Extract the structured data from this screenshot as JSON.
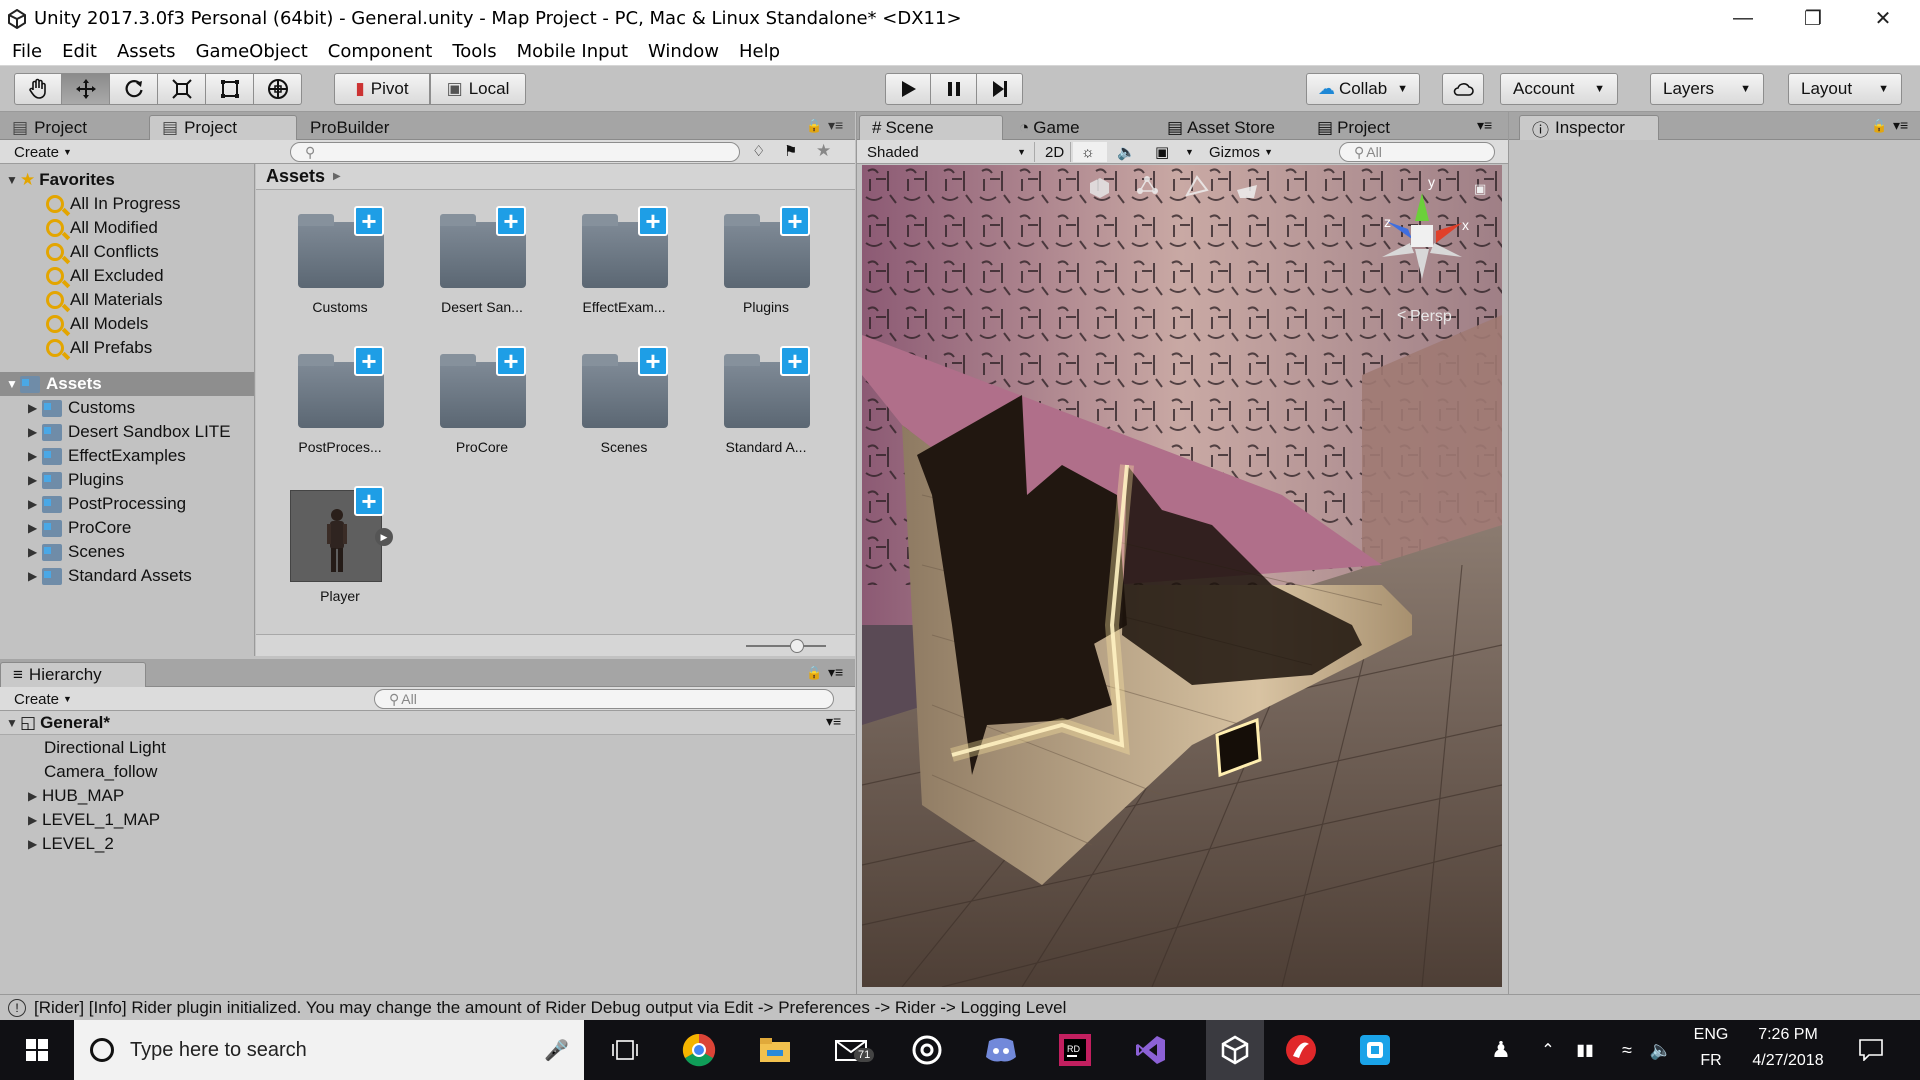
{
  "window": {
    "title": "Unity 2017.3.0f3 Personal (64bit) - General.unity - Map Project - PC, Mac & Linux Standalone* <DX11>"
  },
  "menu": [
    "File",
    "Edit",
    "Assets",
    "GameObject",
    "Component",
    "Tools",
    "Mobile Input",
    "Window",
    "Help"
  ],
  "toolbar": {
    "pivot": "Pivot",
    "local": "Local",
    "collab": "Collab",
    "account": "Account",
    "layers": "Layers",
    "layout": "Layout"
  },
  "project_panel": {
    "tabs": [
      "Project",
      "Project",
      "ProBuilder"
    ],
    "create_label": "Create",
    "breadcrumb": "Assets",
    "favorites_label": "Favorites",
    "favorites": [
      "All In Progress",
      "All Modified",
      "All Conflicts",
      "All Excluded",
      "All Materials",
      "All Models",
      "All Prefabs"
    ],
    "assets_label": "Assets",
    "asset_tree": [
      "Customs",
      "Desert Sandbox LITE",
      "EffectExamples",
      "Plugins",
      "PostProcessing",
      "ProCore",
      "Scenes",
      "Standard Assets"
    ],
    "grid_items": [
      "Customs",
      "Desert San...",
      "EffectExam...",
      "Plugins",
      "PostProces...",
      "ProCore",
      "Scenes",
      "Standard A...",
      "Player"
    ]
  },
  "hierarchy": {
    "tab": "Hierarchy",
    "create_label": "Create",
    "search_placeholder": "All",
    "scene_name": "General*",
    "items": [
      "Directional Light",
      "Camera_follow",
      "HUB_MAP",
      "LEVEL_1_MAP",
      "LEVEL_2"
    ]
  },
  "scene_panel": {
    "tabs": [
      "Scene",
      "Game",
      "Asset Store",
      "Project"
    ],
    "shading": "Shaded",
    "mode_2d": "2D",
    "gizmos": "Gizmos",
    "search_placeholder": "All",
    "persp_label": "Persp",
    "axis_y": "y",
    "axis_x": "x",
    "axis_z": "z"
  },
  "inspector": {
    "tab": "Inspector"
  },
  "status": {
    "message": "[Rider] [Info] Rider plugin initialized. You may change the amount of Rider Debug output via Edit -> Preferences -> Rider -> Logging Level"
  },
  "taskbar": {
    "search_placeholder": "Type here to search",
    "mail_badge": "71",
    "lang_top": "ENG",
    "lang_bottom": "FR",
    "time": "7:26 PM",
    "date": "4/27/2018"
  }
}
